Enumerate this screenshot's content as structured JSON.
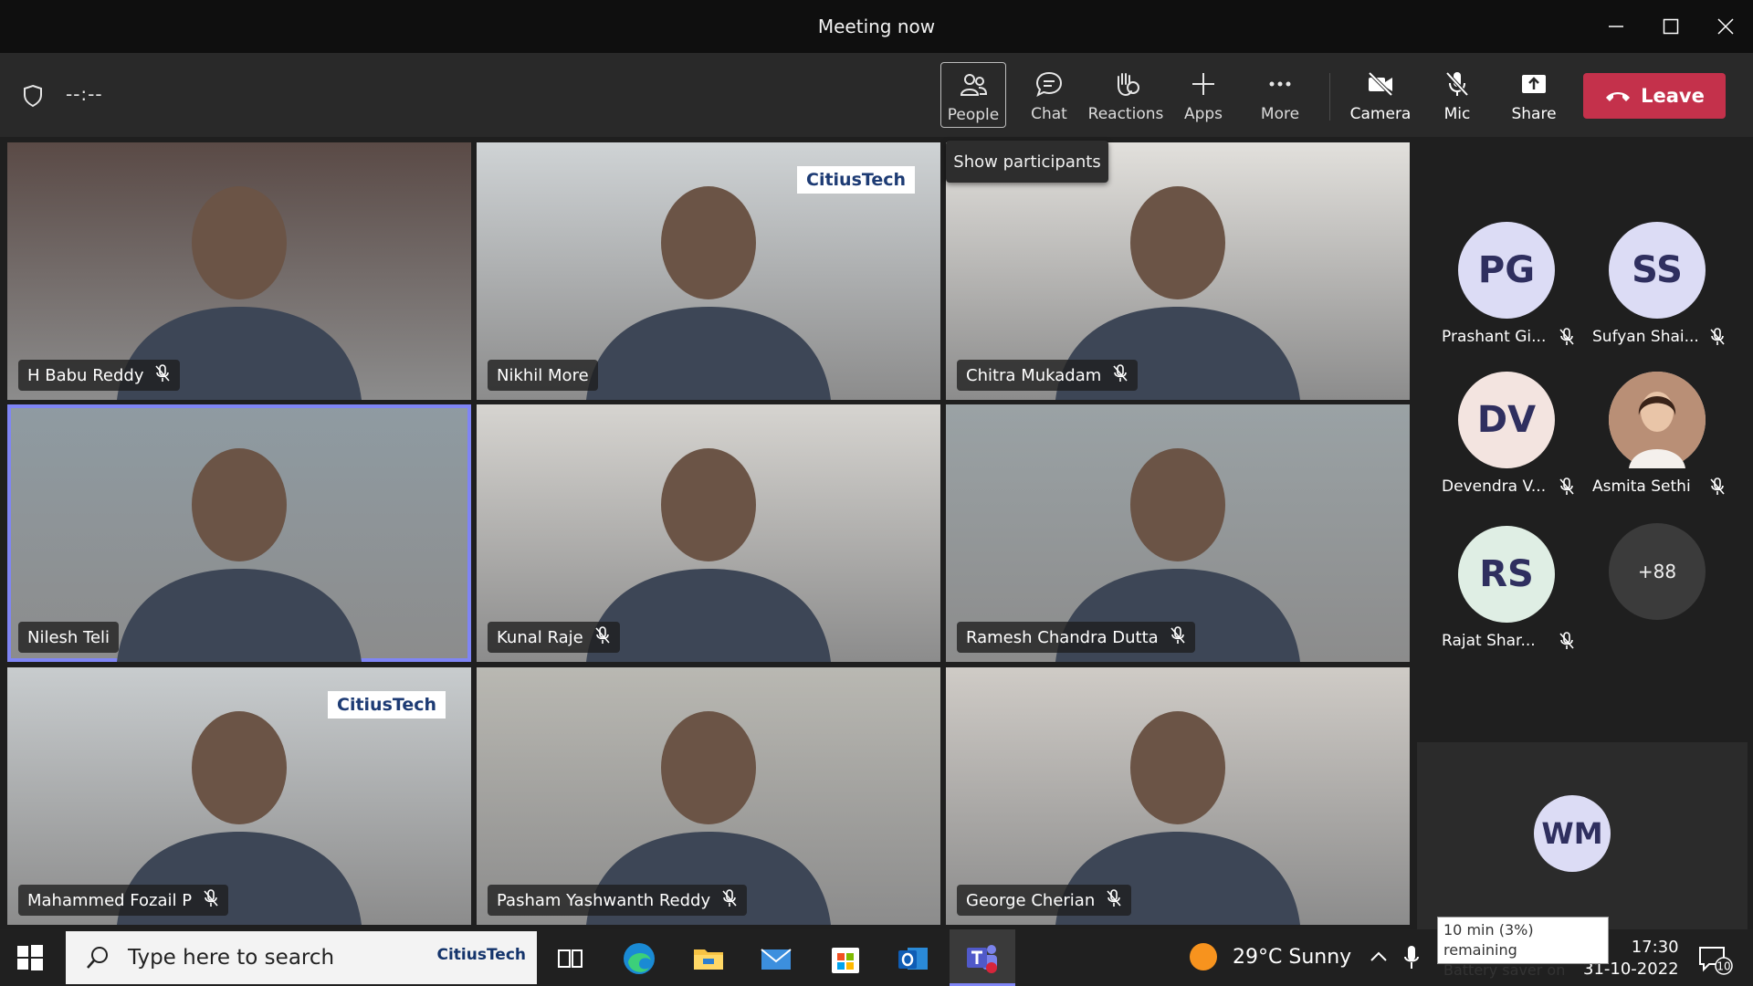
{
  "window": {
    "title": "Meeting now"
  },
  "toolbar": {
    "timer": "--:--",
    "buttons": {
      "people": "People",
      "chat": "Chat",
      "reactions": "Reactions",
      "apps": "Apps",
      "more": "More",
      "camera": "Camera",
      "mic": "Mic",
      "share": "Share"
    },
    "leave": "Leave",
    "tooltip": "Show participants"
  },
  "tiles": [
    {
      "name": "H Babu Reddy",
      "muted": true,
      "bg": "#5a4a46"
    },
    {
      "name": "Nikhil More",
      "muted": false,
      "bg": "#cfd3d5",
      "brand": "CitiusTech"
    },
    {
      "name": "Chitra Mukadam",
      "muted": true,
      "bg": "#e2e0dc"
    },
    {
      "name": "Nilesh Teli",
      "muted": false,
      "bg": "#8f9ba2",
      "speaking": true
    },
    {
      "name": "Kunal Raje",
      "muted": true,
      "bg": "#d6d4d0"
    },
    {
      "name": "Ramesh Chandra Dutta",
      "muted": true,
      "bg": "#9aa2a5"
    },
    {
      "name": "Mahammed Fozail P",
      "muted": true,
      "bg": "#c8ccce",
      "brand": "CitiusTech"
    },
    {
      "name": "Pasham Yashwanth Reddy",
      "muted": true,
      "bg": "#b9b8b2"
    },
    {
      "name": "George Cherian",
      "muted": true,
      "bg": "#cfcbc6"
    }
  ],
  "roster": [
    {
      "initials": "PG",
      "name": "Prashant Gi...",
      "color": "#dcdcf5"
    },
    {
      "initials": "SS",
      "name": "Sufyan Shai...",
      "color": "#dcdcf5"
    },
    {
      "initials": "DV",
      "name": "Devendra V...",
      "color": "#f3e4e0"
    },
    {
      "initials": "",
      "name": "Asmita Sethi",
      "color": "#e8cfc4"
    },
    {
      "initials": "RS",
      "name": "Rajat Shar...",
      "color": "#dfeee4"
    }
  ],
  "roster_more": "+88",
  "self_tile": {
    "initials": "WM",
    "color": "#dcdcf5"
  },
  "taskbar": {
    "search_placeholder": "Type here to search",
    "search_brand": "CitiusTech",
    "weather": "29°C  Sunny",
    "time": "17:30",
    "date": "31-10-2022",
    "notif_count": "10",
    "battery_tooltip_line1": "10 min (3%) remaining",
    "battery_tooltip_line2": "Battery saver on"
  }
}
